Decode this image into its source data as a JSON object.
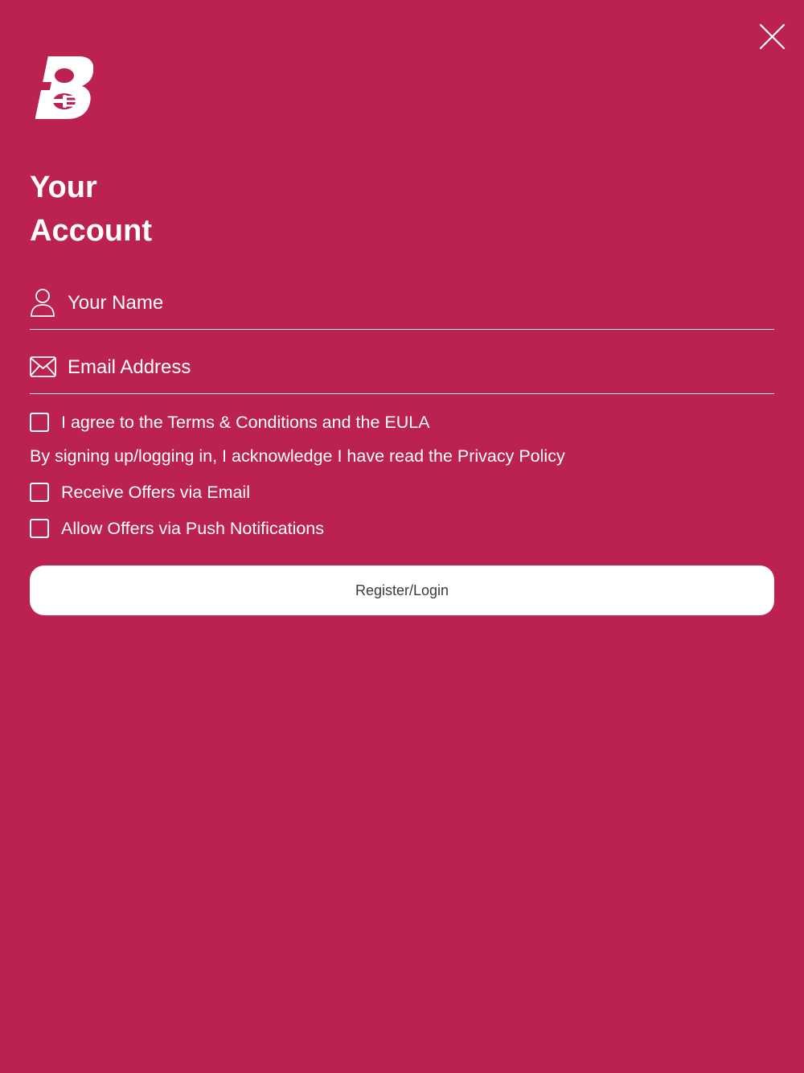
{
  "header": {
    "close_icon": "close-icon",
    "logo_icon": "brand-b-fork-logo"
  },
  "title": {
    "line1": "Your",
    "line2": "Account"
  },
  "form": {
    "name_field": {
      "icon": "person-icon",
      "placeholder": "Your Name",
      "value": ""
    },
    "email_field": {
      "icon": "envelope-icon",
      "placeholder": "Email Address",
      "value": ""
    },
    "terms_checkbox": {
      "label": "I agree to the Terms & Conditions and the EULA",
      "checked": false
    },
    "privacy_note": "By signing up/logging in, I acknowledge I have read the Privacy Policy",
    "offers_email_checkbox": {
      "label": "Receive Offers via Email",
      "checked": false
    },
    "offers_push_checkbox": {
      "label": "Allow Offers via Push Notifications",
      "checked": false
    },
    "submit_label": "Register/Login"
  },
  "colors": {
    "background": "#BB224F",
    "foreground": "#FFFFFF",
    "button_background": "#FFFFFF",
    "button_text": "#3A3A3A"
  }
}
